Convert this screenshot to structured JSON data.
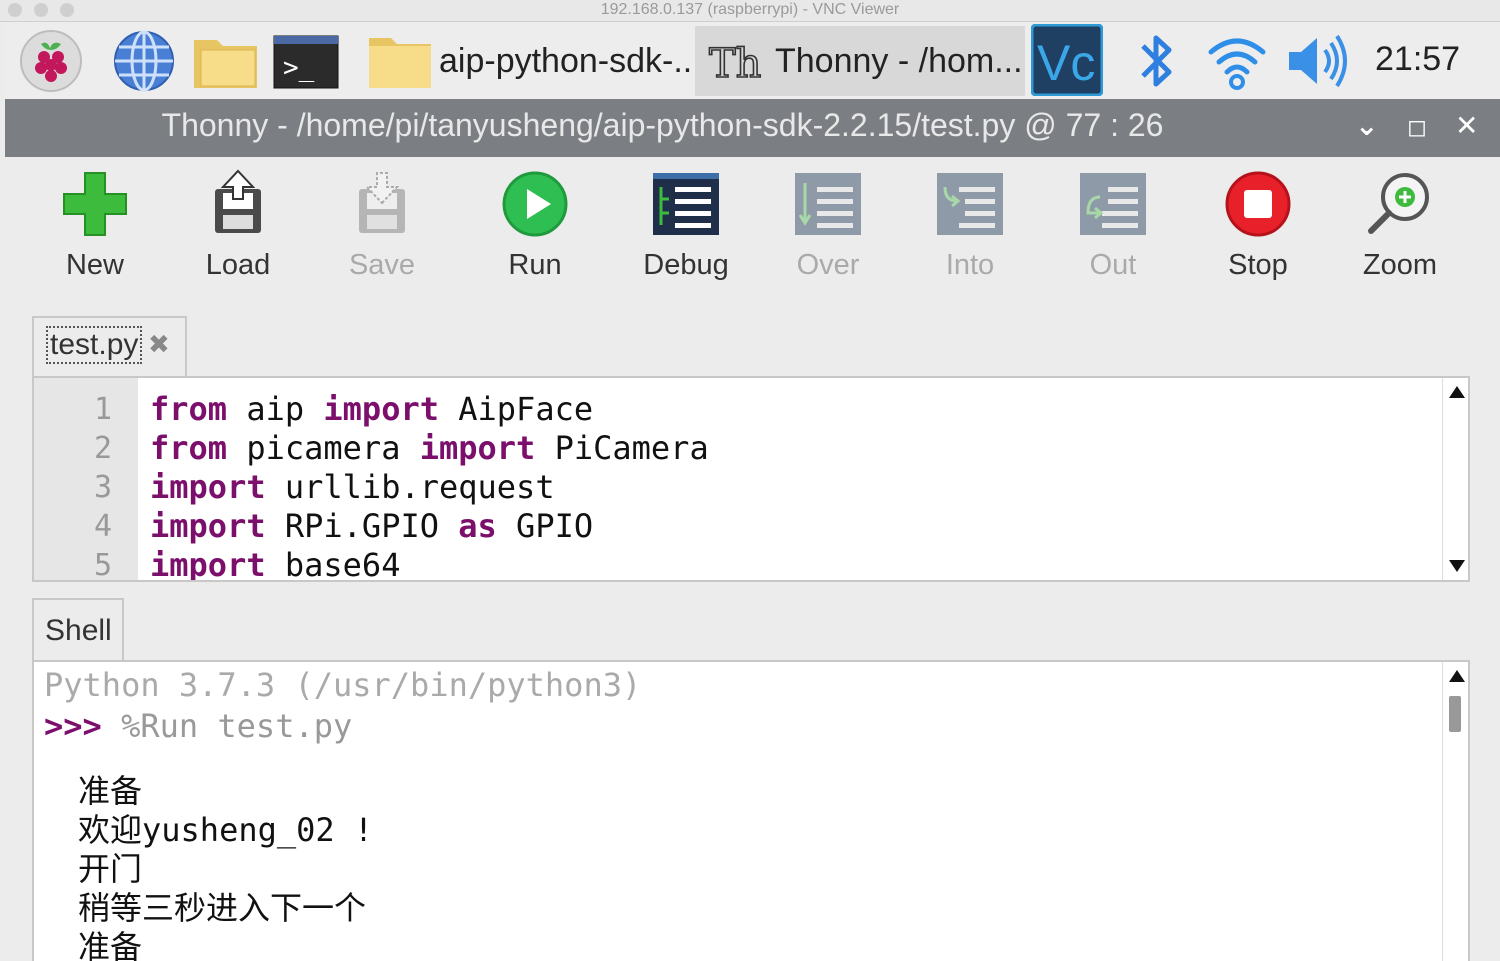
{
  "vnc": {
    "title": "192.168.0.137 (raspberrypi) - VNC Viewer"
  },
  "taskbar": {
    "launchers": [
      "raspberry-menu",
      "web-browser",
      "file-manager",
      "terminal"
    ],
    "tasks": [
      {
        "label": "aip-python-sdk-...",
        "icon": "folder-icon"
      },
      {
        "label": "Thonny  -  /hom...",
        "icon": "thonny-icon"
      }
    ],
    "tray": [
      "vnc-icon",
      "bluetooth-icon",
      "wifi-icon",
      "volume-icon"
    ],
    "clock": "21:57"
  },
  "window": {
    "title": "Thonny  -  /home/pi/tanyusheng/aip-python-sdk-2.2.15/test.py  @  77 : 26"
  },
  "toolbar": {
    "buttons": [
      {
        "label": "New",
        "enabled": true
      },
      {
        "label": "Load",
        "enabled": true
      },
      {
        "label": "Save",
        "enabled": false
      },
      {
        "label": "Run",
        "enabled": true
      },
      {
        "label": "Debug",
        "enabled": true
      },
      {
        "label": "Over",
        "enabled": false
      },
      {
        "label": "Into",
        "enabled": false
      },
      {
        "label": "Out",
        "enabled": false
      },
      {
        "label": "Stop",
        "enabled": true
      },
      {
        "label": "Zoom",
        "enabled": true
      }
    ]
  },
  "editor": {
    "tab_label": "test.py",
    "close_glyph": "✖",
    "line_numbers": [
      "1",
      "2",
      "3",
      "4",
      "5"
    ],
    "lines": [
      {
        "kw1": "from",
        "t1": " aip ",
        "kw2": "import",
        "t2": " AipFace"
      },
      {
        "kw1": "from",
        "t1": " picamera ",
        "kw2": "import",
        "t2": " PiCamera"
      },
      {
        "kw1": "import",
        "t1": " urllib.request",
        "kw2": "",
        "t2": ""
      },
      {
        "kw1": "import",
        "t1": " RPi.GPIO ",
        "kw2": "as",
        "t2": " GPIO"
      },
      {
        "kw1": "import",
        "t1": " base64",
        "kw2": "",
        "t2": ""
      }
    ]
  },
  "shell": {
    "tab_label": "Shell",
    "banner": "Python 3.7.3 (/usr/bin/python3)",
    "prompt": ">>>",
    "command": "%Run test.py",
    "output": [
      "准备",
      "欢迎yusheng_02 !",
      "开门",
      "稍等三秒进入下一个",
      "准备"
    ]
  }
}
